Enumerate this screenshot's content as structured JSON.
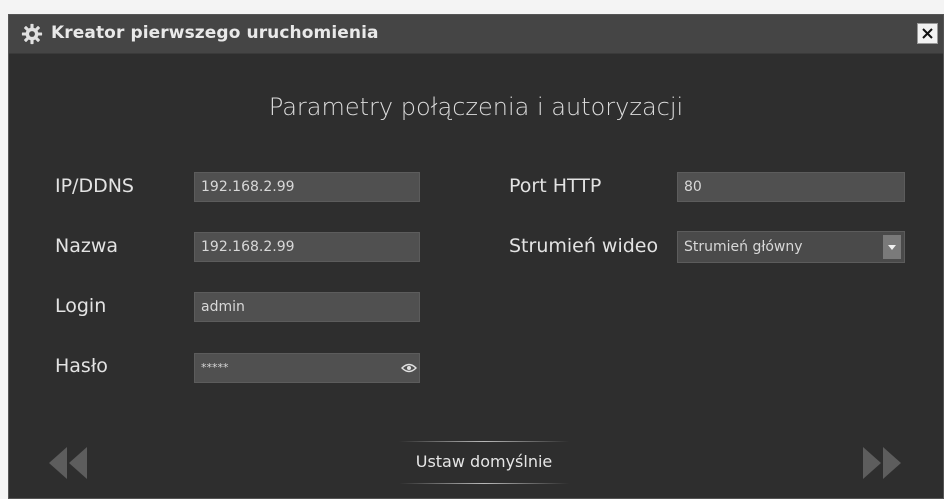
{
  "window": {
    "title": "Kreator pierwszego uruchomienia",
    "title_icon": "gear-icon",
    "close_icon": "close-icon"
  },
  "heading": "Parametry połączenia i autoryzacji",
  "form": {
    "ip_label": "IP/DDNS",
    "ip_value": "192.168.2.99",
    "name_label": "Nazwa",
    "name_value": "192.168.2.99",
    "login_label": "Login",
    "login_value": "admin",
    "password_label": "Hasło",
    "password_value": "*****",
    "password_toggle_icon": "eye-icon",
    "port_label": "Port HTTP",
    "port_value": "80",
    "stream_label": "Strumień wideo",
    "stream_value": "Strumień główny"
  },
  "footer": {
    "default_button_label": "Ustaw domyślnie",
    "prev_icon": "double-chevron-left-icon",
    "next_icon": "double-chevron-right-icon"
  },
  "colors": {
    "window_bg": "#2e2e2e",
    "titlebar_bg": "#454545",
    "field_bg": "#505050",
    "text": "#e3e3e3"
  }
}
